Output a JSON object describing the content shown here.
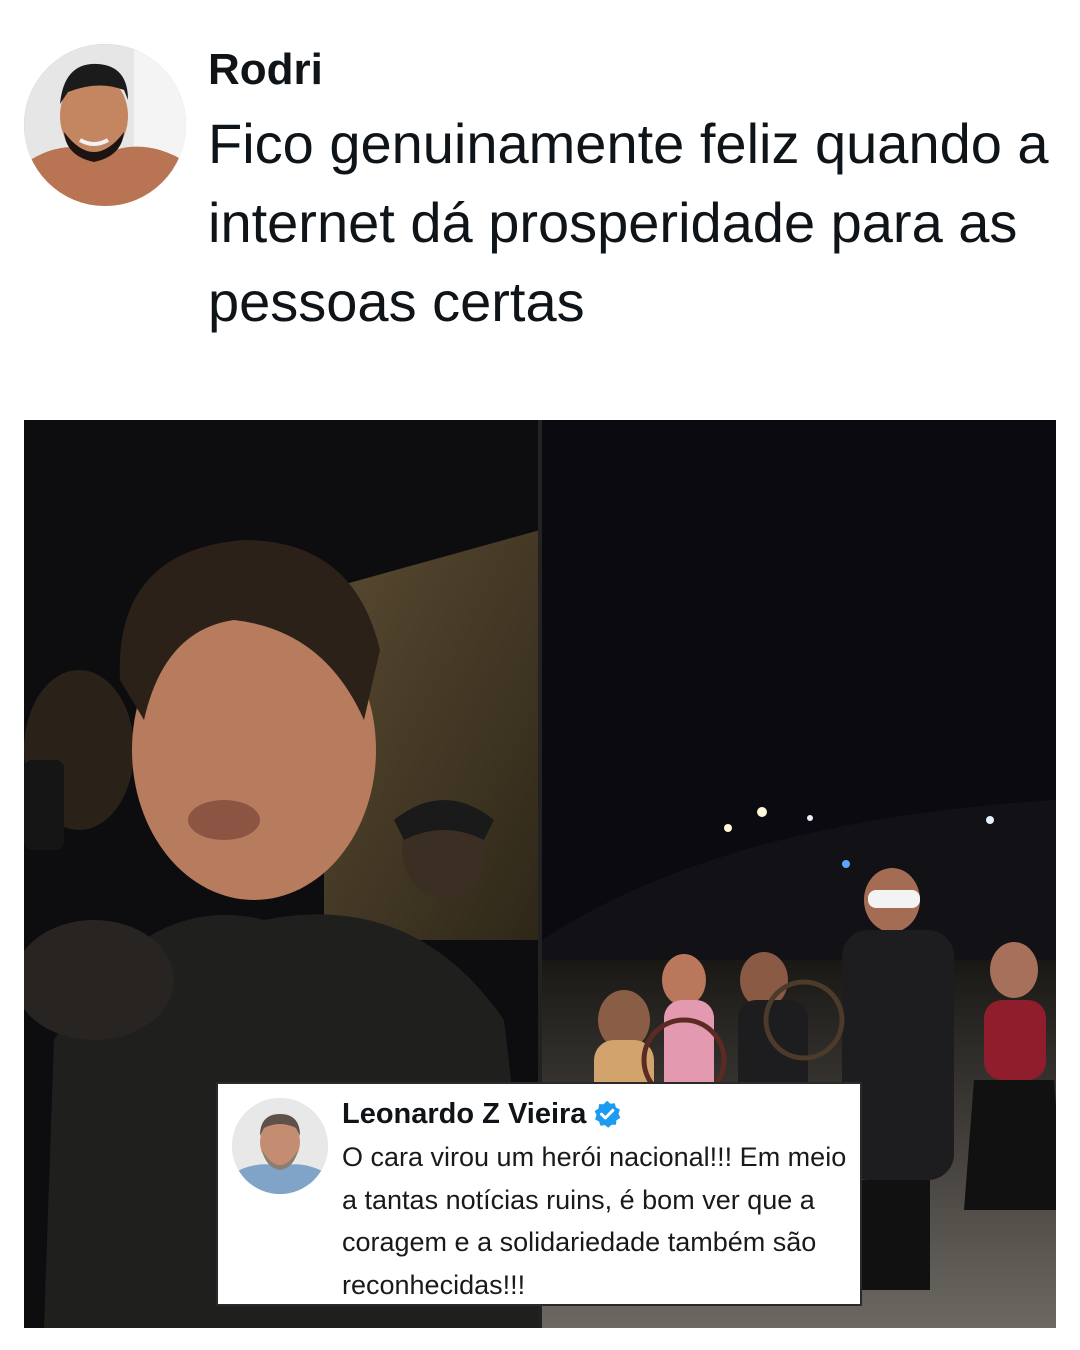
{
  "tweet": {
    "author_name": "Rodri",
    "text": "Fico genuinamente feliz quando a internet dá prosperidade para as pessoas certas"
  },
  "media": {
    "left_frame": "man-in-dark-shirt-at-night",
    "right_frame": "blindfolded-group-on-street-at-night"
  },
  "reply": {
    "author_name": "Leonardo Z Vieira",
    "verified": true,
    "verified_color": "#1d9bf0",
    "text": "O cara virou um herói nacional!!! Em meio a tantas notícias ruins, é bom ver que a coragem e a solidariedade também são reconhecidas!!!"
  }
}
